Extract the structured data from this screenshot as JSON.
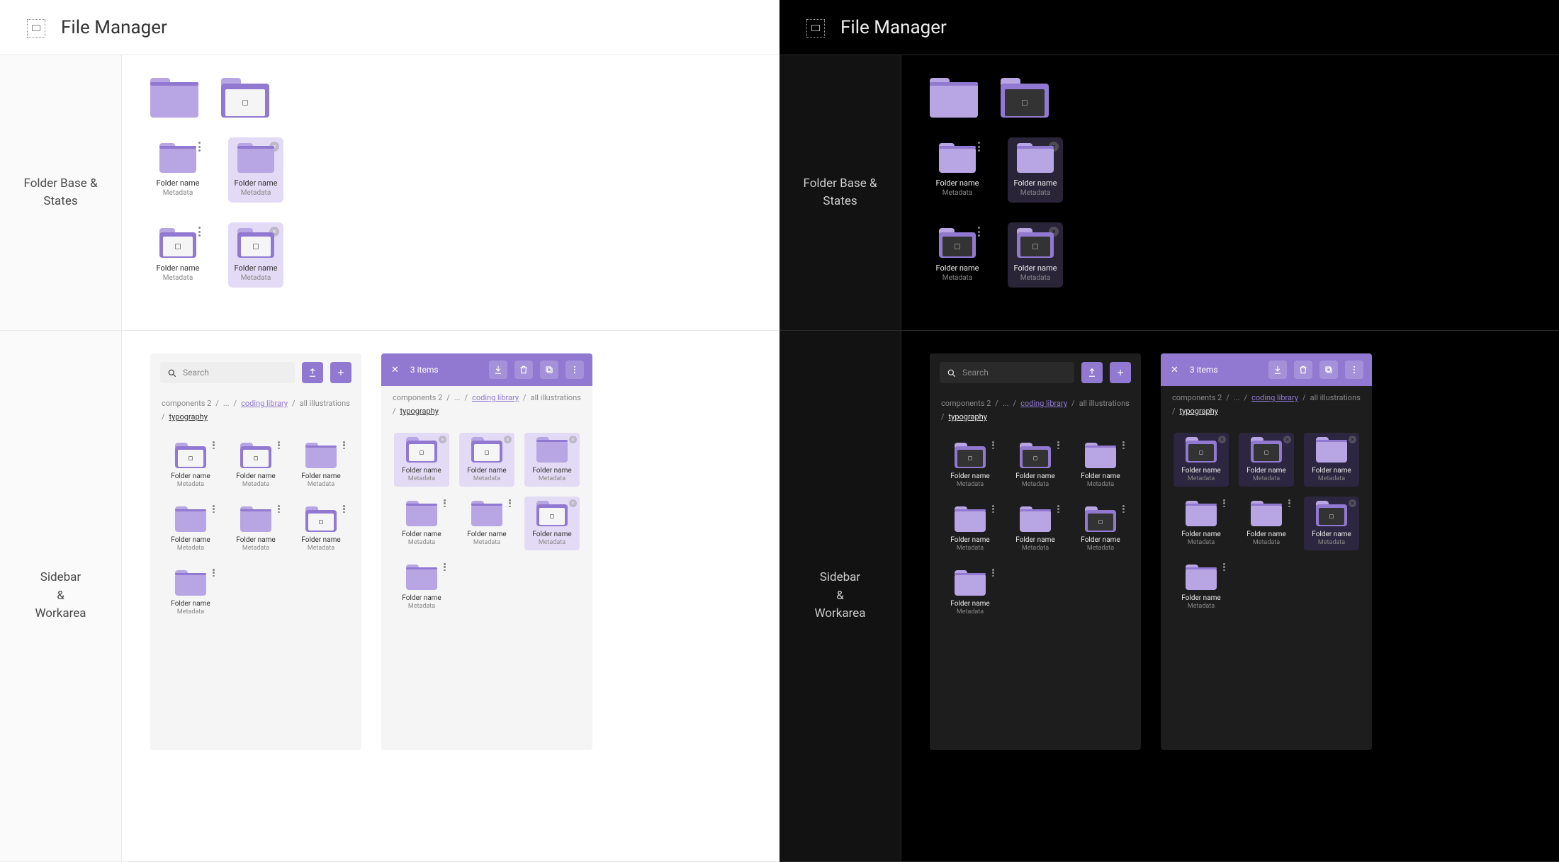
{
  "app": {
    "title": "File Manager"
  },
  "sections": {
    "folder_states": {
      "label": "Folder Base &\nStates"
    },
    "workarea": {
      "label": "Sidebar\n&\nWorkarea"
    }
  },
  "folder_tile": {
    "name": "Folder name",
    "meta": "Metadata"
  },
  "toolbar": {
    "search_placeholder": "Search",
    "selection_count": "3 items"
  },
  "breadcrumb": {
    "root": "components 2",
    "ellipsis": "...",
    "link": "coding library",
    "mid": "all illustrations",
    "current": "typography",
    "sep": "/"
  },
  "workarea_items": [
    {
      "open": true,
      "selected_in_sel": true
    },
    {
      "open": true,
      "selected_in_sel": true
    },
    {
      "open": false,
      "selected_in_sel": true
    },
    {
      "open": false,
      "selected_in_sel": false
    },
    {
      "open": false,
      "selected_in_sel": false
    },
    {
      "open": true,
      "selected_in_sel": true
    },
    {
      "open": false,
      "selected_in_sel": false
    }
  ]
}
